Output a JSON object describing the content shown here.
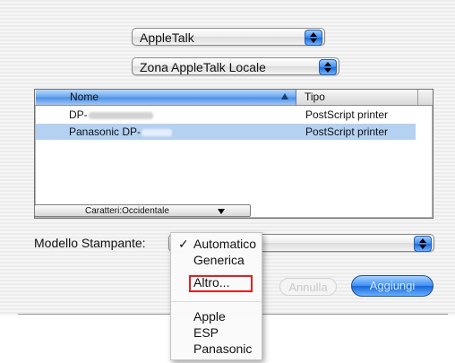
{
  "popups": {
    "protocol": "AppleTalk",
    "zone": "Zona AppleTalk Locale"
  },
  "table": {
    "columns": [
      "Nome",
      "Tipo"
    ],
    "rows": [
      {
        "nome": "DP-",
        "tipo": "PostScript printer",
        "selected": false
      },
      {
        "nome": "Panasonic DP-",
        "tipo": "PostScript printer",
        "selected": true
      }
    ],
    "encoding": "Caratteri:Occidentale"
  },
  "model": {
    "label": "Modello Stampante:",
    "menu": [
      "Automatico",
      "Generica",
      "Altro...",
      "Apple",
      "ESP",
      "Panasonic"
    ],
    "checked": "Automatico",
    "highlighted": "Altro..."
  },
  "buttons": {
    "cancel": "Annulla",
    "add": "Aggiungi"
  },
  "colors": {
    "selection": "#b5d1f2",
    "accent": "#3b8ef2",
    "highlight_frame": "#e02020"
  }
}
